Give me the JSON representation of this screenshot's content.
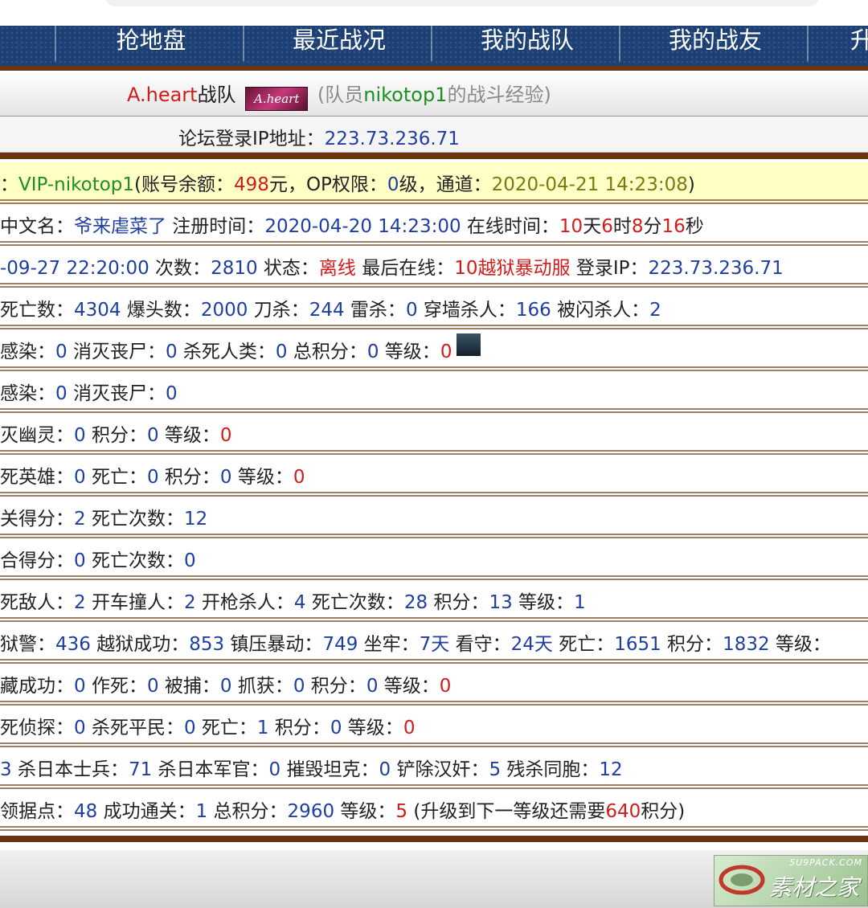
{
  "nav": [
    "抢地盘",
    "最近战况",
    "我的战队",
    "我的战友",
    "升"
  ],
  "team": {
    "name_a": "A.heart",
    "name_b": "战队",
    "logo_text": "A.heart",
    "open": "(队员",
    "member": "nikotop1",
    "close": "的战斗经验)"
  },
  "ip": {
    "label": "论坛登录IP地址：",
    "value": "223.73.236.71"
  },
  "account": {
    "prefix": "：",
    "vip": "VIP-nikotop1",
    "balance_label": "(账号余额：",
    "balance": "498",
    "balance_unit": "元，OP权限：",
    "op": "0",
    "level_unit": "级，通道：",
    "time": "2020-04-21 14:23:08",
    "close": ")"
  },
  "profile": {
    "cn_label": "中文名：",
    "cn_name": "爷来虐菜了",
    "reg_label": " 注册时间：",
    "reg_time": "2020-04-20 14:23:00",
    "online_label": " 在线时间：",
    "d": "10",
    "d_u": "天",
    "h": "6",
    "h_u": "时",
    "m": "8",
    "m_u": "分",
    "s": "16",
    "s_u": "秒"
  },
  "login": {
    "time": "-09-27 22:20:00",
    "count_label": " 次数：",
    "count": "2810",
    "status_label": " 状态：",
    "status": "离线",
    "last_label": " 最后在线：",
    "last": "10越狱暴动服",
    "ip_label": " 登录IP：",
    "ip": "223.73.236.71"
  },
  "kills": {
    "death_label": "死亡数：",
    "death": "4304",
    "hs_label": " 爆头数：",
    "hs": "2000",
    "knife_label": " 刀杀：",
    "knife": "244",
    "nade_label": " 雷杀：",
    "nade": "0",
    "wall_label": " 穿墙杀人：",
    "wall": "166",
    "flash_label": " 被闪杀人：",
    "flash": "2"
  },
  "zombie1": {
    "a_label": "感染：",
    "a": "0",
    "b_label": " 消灭丧尸：",
    "b": "0",
    "c_label": " 杀死人类：",
    "c": "0",
    "d_label": " 总积分：",
    "d": "0",
    "e_label": " 等级：",
    "e": "0",
    "avatar_icon": "player-avatar"
  },
  "zombie2": {
    "a_label": "感染：",
    "a": "0",
    "b_label": " 消灭丧尸：",
    "b": "0"
  },
  "ghost": {
    "a_label": "灭幽灵：",
    "a": "0",
    "b_label": " 积分：",
    "b": "0",
    "c_label": " 等级：",
    "c": "0"
  },
  "hero": {
    "a_label": "死英雄：",
    "a": "0",
    "b_label": " 死亡：",
    "b": "0",
    "c_label": " 积分：",
    "c": "0",
    "d_label": " 等级：",
    "d": "0"
  },
  "score1": {
    "a_label": "关得分：",
    "a": "2",
    "b_label": " 死亡次数：",
    "b": "12"
  },
  "score2": {
    "a_label": "合得分：",
    "a": "0",
    "b_label": " 死亡次数：",
    "b": "0"
  },
  "vehicle": {
    "a_label": "死敌人：",
    "a": "2",
    "b_label": " 开车撞人：",
    "b": "2",
    "c_label": " 开枪杀人：",
    "c": "4",
    "d_label": " 死亡次数：",
    "d": "28",
    "e_label": " 积分：",
    "e": "13",
    "f_label": " 等级：",
    "f": "1"
  },
  "jail": {
    "a_label": "狱警：",
    "a": "436",
    "b_label": " 越狱成功：",
    "b": "853",
    "c_label": " 镇压暴动：",
    "c": "749",
    "d_label": " 坐牢：",
    "d": "7天",
    "e_label": " 看守：",
    "e": "24天",
    "f_label": " 死亡：",
    "f": "1651",
    "g_label": " 积分：",
    "g": "1832",
    "h_label": " 等级："
  },
  "hide": {
    "a_label": "藏成功：",
    "a": "0",
    "b_label": " 作死：",
    "b": "0",
    "c_label": " 被捕：",
    "c": "0",
    "d_label": " 抓获：",
    "d": "0",
    "e_label": " 积分：",
    "e": "0",
    "f_label": " 等级：",
    "f": "0"
  },
  "detective": {
    "a_label": "死侦探：",
    "a": "0",
    "b_label": " 杀死平民：",
    "b": "0",
    "c_label": " 死亡：",
    "c": "1",
    "d_label": " 积分：",
    "d": "0",
    "e_label": " 等级：",
    "e": "0"
  },
  "war": {
    "lead": "3",
    "a_label": " 杀日本士兵：",
    "a": "71",
    "b_label": " 杀日本军官：",
    "b": "0",
    "c_label": " 摧毁坦克：",
    "c": "0",
    "d_label": " 铲除汉奸：",
    "d": "5",
    "e_label": " 残杀同胞：",
    "e": "12"
  },
  "territory": {
    "a_label": "领据点：",
    "a": "48",
    "b_label": " 成功通关：",
    "b": "1",
    "c_label": " 总积分：",
    "c": "2960",
    "d_label": " 等级：",
    "d": "5",
    "e_label": " (升级到下一等级还需要",
    "e": "640",
    "f_label": "积分)"
  },
  "watermark": {
    "top": "5U9PACK.COM",
    "main": "素材之家"
  }
}
